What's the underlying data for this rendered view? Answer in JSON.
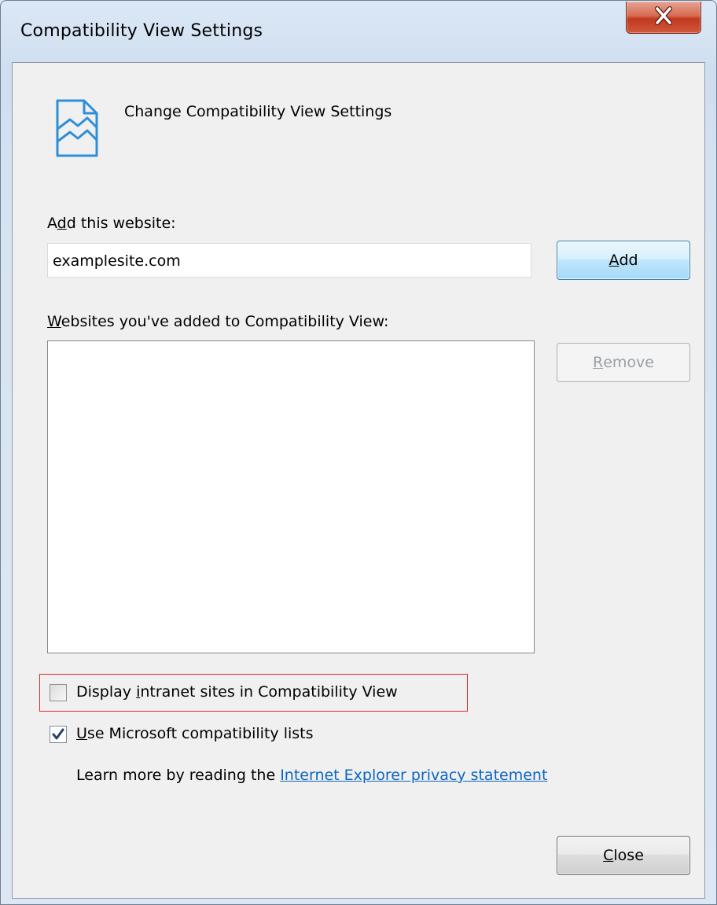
{
  "window": {
    "title": "Compatibility View Settings",
    "close_glyph": "X"
  },
  "header": {
    "icon": "compatibility-view-icon",
    "text": "Change Compatibility View Settings"
  },
  "add_site": {
    "label_prefix": "A",
    "label_accel": "d",
    "label_suffix": "d this website:",
    "input_value": "examplesite.com",
    "button_accel": "A",
    "button_rest": "dd"
  },
  "site_list": {
    "label_accel": "W",
    "label_rest": "ebsites you've added to Compatibility View:",
    "items": [],
    "remove_accel": "R",
    "remove_rest": "emove"
  },
  "options": {
    "intranet_prefix": "Display ",
    "intranet_accel": "i",
    "intranet_suffix": "ntranet sites in Compatibility View",
    "intranet_checked": false,
    "mslists_accel": "U",
    "mslists_rest": "se Microsoft compatibility lists",
    "mslists_checked": true
  },
  "learn_more": {
    "text": "Learn more by reading the",
    "link": "Internet Explorer privacy statement"
  },
  "footer": {
    "close_accel": "C",
    "close_rest": "lose"
  },
  "colors": {
    "link": "#0d66c2",
    "highlight": "#e0262a",
    "close_button": "#c2381f"
  }
}
